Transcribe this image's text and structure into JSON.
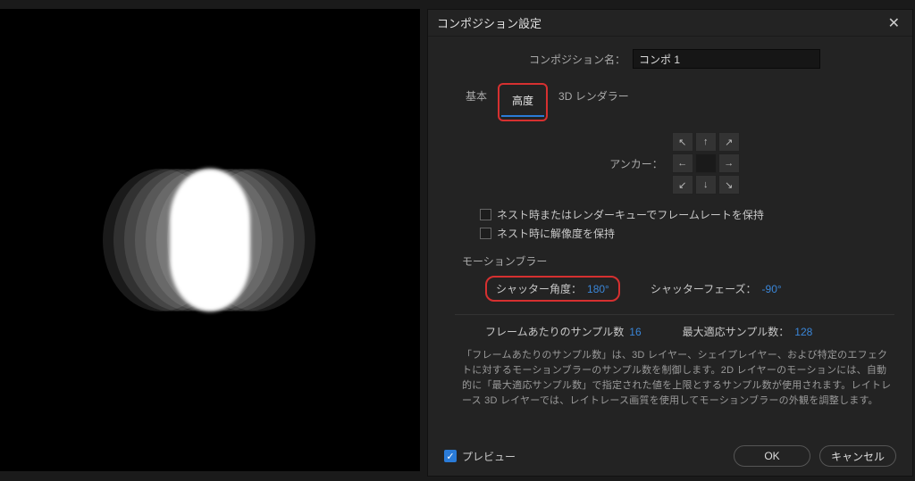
{
  "dialog": {
    "title": "コンポジション設定",
    "comp_name_label": "コンポジション名：",
    "comp_name_value": "コンポ 1",
    "tabs": {
      "basic": "基本",
      "advanced": "高度",
      "renderer": "3D レンダラー"
    },
    "anchor_label": "アンカー：",
    "anchor_arrows": [
      "↖",
      "↑",
      "↗",
      "←",
      "",
      "→",
      "↙",
      "↓",
      "↘"
    ],
    "checks": {
      "nest_framerate": "ネスト時またはレンダーキューでフレームレートを保持",
      "nest_resolution": "ネスト時に解像度を保持"
    },
    "motion_blur": {
      "section": "モーションブラー",
      "shutter_angle_label": "シャッター角度：",
      "shutter_angle_value": "180°",
      "shutter_phase_label": "シャッターフェーズ：",
      "shutter_phase_value": "-90°",
      "samples_per_frame_label": "フレームあたりのサンプル数",
      "samples_per_frame_value": "16",
      "adaptive_limit_label": "最大適応サンプル数：",
      "adaptive_limit_value": "128",
      "description": "「フレームあたりのサンプル数」は、3D レイヤー、シェイプレイヤー、および特定のエフェクトに対するモーションブラーのサンプル数を制御します。2D レイヤーのモーションには、自動的に「最大適応サンプル数」で指定された値を上限とするサンプル数が使用されます。レイトレース 3D レイヤーでは、レイトレース画質を使用してモーションブラーの外観を調整します。"
    },
    "footer": {
      "preview": "プレビュー",
      "ok": "OK",
      "cancel": "キャンセル"
    }
  }
}
